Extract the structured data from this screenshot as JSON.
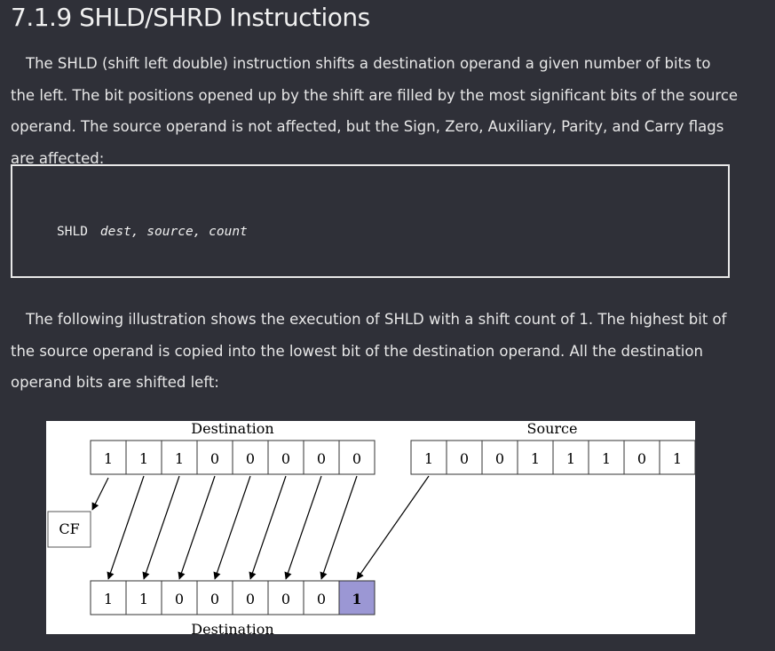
{
  "section_title": "7.1.9 SHLD/SHRD Instructions",
  "paragraph1": "The SHLD (shift left double) instruction shifts a destination operand a given number of bits to the left. The bit positions opened up by the shift are filled by the most significant bits of the source operand. The source operand is not affected, but the Sign, Zero, Auxiliary, Parity, and Carry flags are affected:",
  "code": {
    "keyword": "SHLD",
    "args": "dest, source, count"
  },
  "paragraph2": "The following illustration shows the execution of SHLD with a shift count of 1. The highest bit of the source operand is copied into the lowest bit of the destination operand. All the destination operand bits are shifted left:",
  "figure": {
    "top_dest_label": "Destination",
    "source_label": "Source",
    "bottom_dest_label": "Destination",
    "cf_label": "CF",
    "dest_bits": [
      "1",
      "1",
      "1",
      "0",
      "0",
      "0",
      "0",
      "0"
    ],
    "source_bits": [
      "1",
      "0",
      "0",
      "1",
      "1",
      "1",
      "0",
      "1"
    ],
    "result_bits": [
      "1",
      "1",
      "0",
      "0",
      "0",
      "0",
      "0",
      "1"
    ],
    "highlight_color": "#9b97d4"
  }
}
